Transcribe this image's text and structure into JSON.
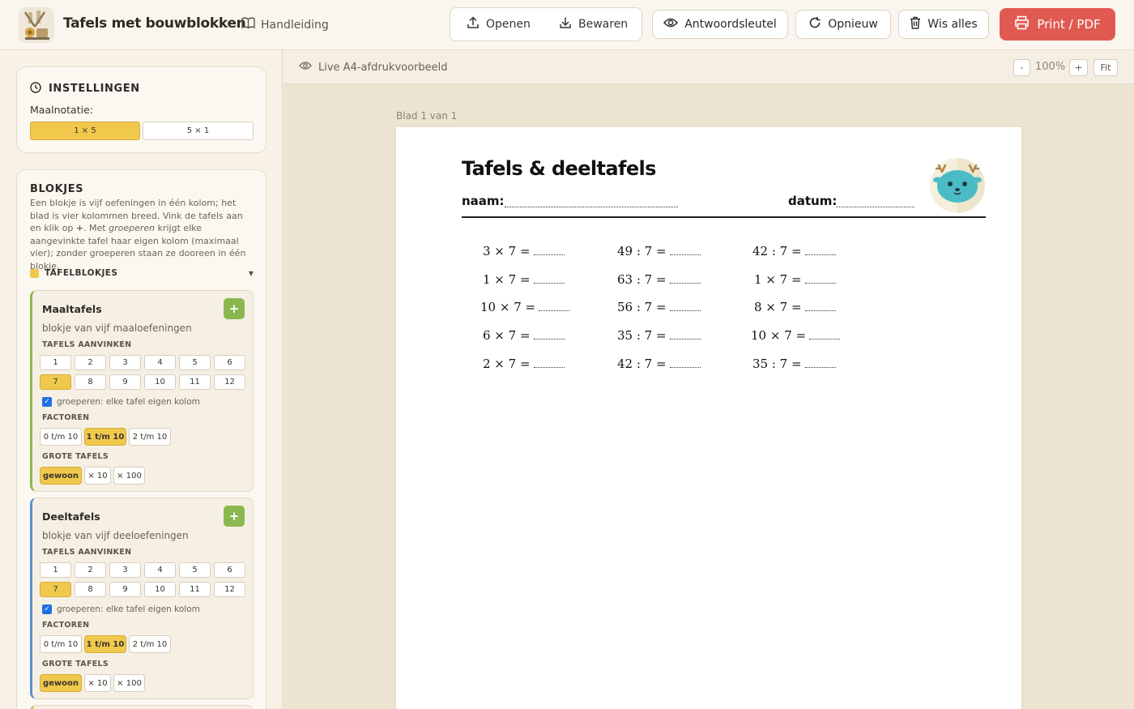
{
  "header": {
    "app_title": "Tafels met bouwblokken",
    "manual_label": "Handleiding",
    "open_label": "Openen",
    "save_label": "Bewaren",
    "answer_key_label": "Antwoordsleutel",
    "reset_label": "Opnieuw",
    "clear_label": "Wis alles",
    "print_label": "Print / PDF"
  },
  "settings": {
    "title": "INSTELLINGEN",
    "notation_label": "Maalnotatie:",
    "notation_options": [
      "1 × 5",
      "5 × 1"
    ],
    "notation_selected": "1 × 5"
  },
  "blocks": {
    "title": "BLOKJES",
    "desc_1": "Een blokje is vijf oefeningen in één kolom; het blad is vier kolommen breed. Vink de tafels aan en klik op",
    "desc_plus": "+",
    "desc_2": ". Met",
    "desc_em": "groeperen",
    "desc_3": "krijgt elke aangevinkte tafel haar eigen kolom (maximaal vier); zonder groeperen staan ze dooreen in één blokje.",
    "group_label": "TAFELBLOKJES",
    "items": [
      {
        "title": "Maaltafels",
        "subtitle": "blokje van vijf maaloefeningen",
        "tables_label": "TAFELS AANVINKEN",
        "tables": [
          "1",
          "2",
          "3",
          "4",
          "5",
          "6",
          "7",
          "8",
          "9",
          "10",
          "11",
          "12"
        ],
        "selected_table": "7",
        "group_text": "groeperen: elke tafel eigen kolom",
        "factors_label": "FACTOREN",
        "factors": [
          "0 t/m 10",
          "1 t/m 10",
          "2 t/m 10"
        ],
        "factors_selected": "1 t/m 10",
        "big_label": "GROTE TAFELS",
        "big": [
          "gewoon",
          "× 10",
          "× 100"
        ],
        "big_selected": "gewoon",
        "accent": "#8ab84e"
      },
      {
        "title": "Deeltafels",
        "subtitle": "blokje van vijf deeloefeningen",
        "tables_label": "TAFELS AANVINKEN",
        "tables": [
          "1",
          "2",
          "3",
          "4",
          "5",
          "6",
          "7",
          "8",
          "9",
          "10",
          "11",
          "12"
        ],
        "selected_table": "7",
        "group_text": "groeperen: elke tafel eigen kolom",
        "factors_label": "FACTOREN",
        "factors": [
          "0 t/m 10",
          "1 t/m 10",
          "2 t/m 10"
        ],
        "factors_selected": "1 t/m 10",
        "big_label": "GROTE TAFELS",
        "big": [
          "gewoon",
          "× 10",
          "× 100"
        ],
        "big_selected": "gewoon",
        "accent": "#5b8fd0"
      }
    ]
  },
  "preview": {
    "label": "Live A4-afdrukvoorbeeld",
    "zoom_minus": "-",
    "zoom_value": "100%",
    "zoom_plus": "+",
    "fit_label": "Fit",
    "sheet_label": "Blad 1 van 1"
  },
  "worksheet": {
    "title": "Tafels & deeltafels",
    "name_label": "naam:",
    "date_label": "datum:",
    "columns": [
      [
        "3 × 7 =",
        "1 × 7 =",
        "10 × 7 =",
        "6 × 7 =",
        "2 × 7 ="
      ],
      [
        "49 : 7 =",
        "63 : 7 =",
        "56 : 7 =",
        "35 : 7 =",
        "42 : 7 ="
      ],
      [
        "42 : 7 =",
        "1 × 7 =",
        "8 × 7 =",
        "10 × 7 =",
        "35 : 7 ="
      ]
    ]
  },
  "colors": {
    "print_button": "#e05a52",
    "selected": "#f0c84c",
    "add_button": "#8ab84e"
  }
}
